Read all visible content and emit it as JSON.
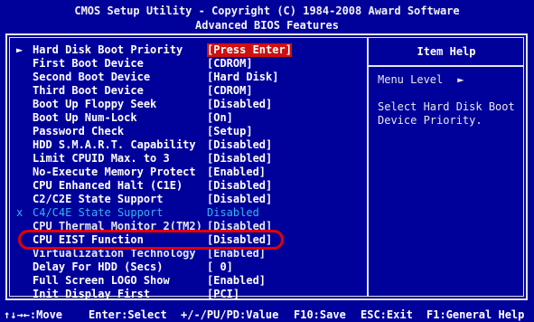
{
  "header": {
    "title": "CMOS Setup Utility - Copyright (C) 1984-2008 Award Software",
    "subtitle": "Advanced BIOS Features"
  },
  "menu": {
    "items": [
      {
        "marker": "►",
        "label": "Hard Disk Boot Priority",
        "value": "[Press Enter]",
        "highlight": true
      },
      {
        "marker": "",
        "label": "First Boot Device",
        "value": "[CDROM]"
      },
      {
        "marker": "",
        "label": "Second Boot Device",
        "value": "[Hard Disk]"
      },
      {
        "marker": "",
        "label": "Third Boot Device",
        "value": "[CDROM]"
      },
      {
        "marker": "",
        "label": "Boot Up Floppy Seek",
        "value": "[Disabled]"
      },
      {
        "marker": "",
        "label": "Boot Up Num-Lock",
        "value": "[On]"
      },
      {
        "marker": "",
        "label": "Password Check",
        "value": "[Setup]"
      },
      {
        "marker": "",
        "label": "HDD S.M.A.R.T. Capability",
        "value": "[Disabled]"
      },
      {
        "marker": "",
        "label": "Limit CPUID Max. to 3",
        "value": "[Disabled]"
      },
      {
        "marker": "",
        "label": "No-Execute Memory Protect",
        "value": "[Enabled]"
      },
      {
        "marker": "",
        "label": "CPU Enhanced Halt (C1E)",
        "value": "[Disabled]"
      },
      {
        "marker": "",
        "label": "C2/C2E State Support",
        "value": "[Disabled]"
      },
      {
        "marker": "x",
        "label": "C4/C4E State Support",
        "value": "Disabled",
        "disabled": true
      },
      {
        "marker": "",
        "label": "CPU Thermal Monitor 2(TM2)",
        "value": "[Disabled]"
      },
      {
        "marker": "",
        "label": "CPU EIST Function",
        "value": "[Disabled]"
      },
      {
        "marker": "",
        "label": "Virtualization Technology",
        "value": "[Enabled]"
      },
      {
        "marker": "",
        "label": "Delay For HDD (Secs)",
        "value": "[ 0]"
      },
      {
        "marker": "",
        "label": "Full Screen LOGO Show",
        "value": "[Enabled]"
      },
      {
        "marker": "",
        "label": "Init Display First",
        "value": "[PCI]"
      }
    ]
  },
  "help": {
    "title": "Item Help",
    "menu_level_label": "Menu Level",
    "menu_level_arrow": "►",
    "text": "Select Hard Disk Boot Device Priority."
  },
  "footer": {
    "move": "↑↓→←:Move",
    "select": "Enter:Select",
    "value": "+/-/PU/PD:Value",
    "save": "F10:Save",
    "exit": "ESC:Exit",
    "help": "F1:General Help"
  },
  "colors": {
    "background": "#00009a",
    "text": "#ffffff",
    "disabled_text": "#36b3f2",
    "highlight": "#d01010",
    "annotation_circle": "#e40000"
  }
}
